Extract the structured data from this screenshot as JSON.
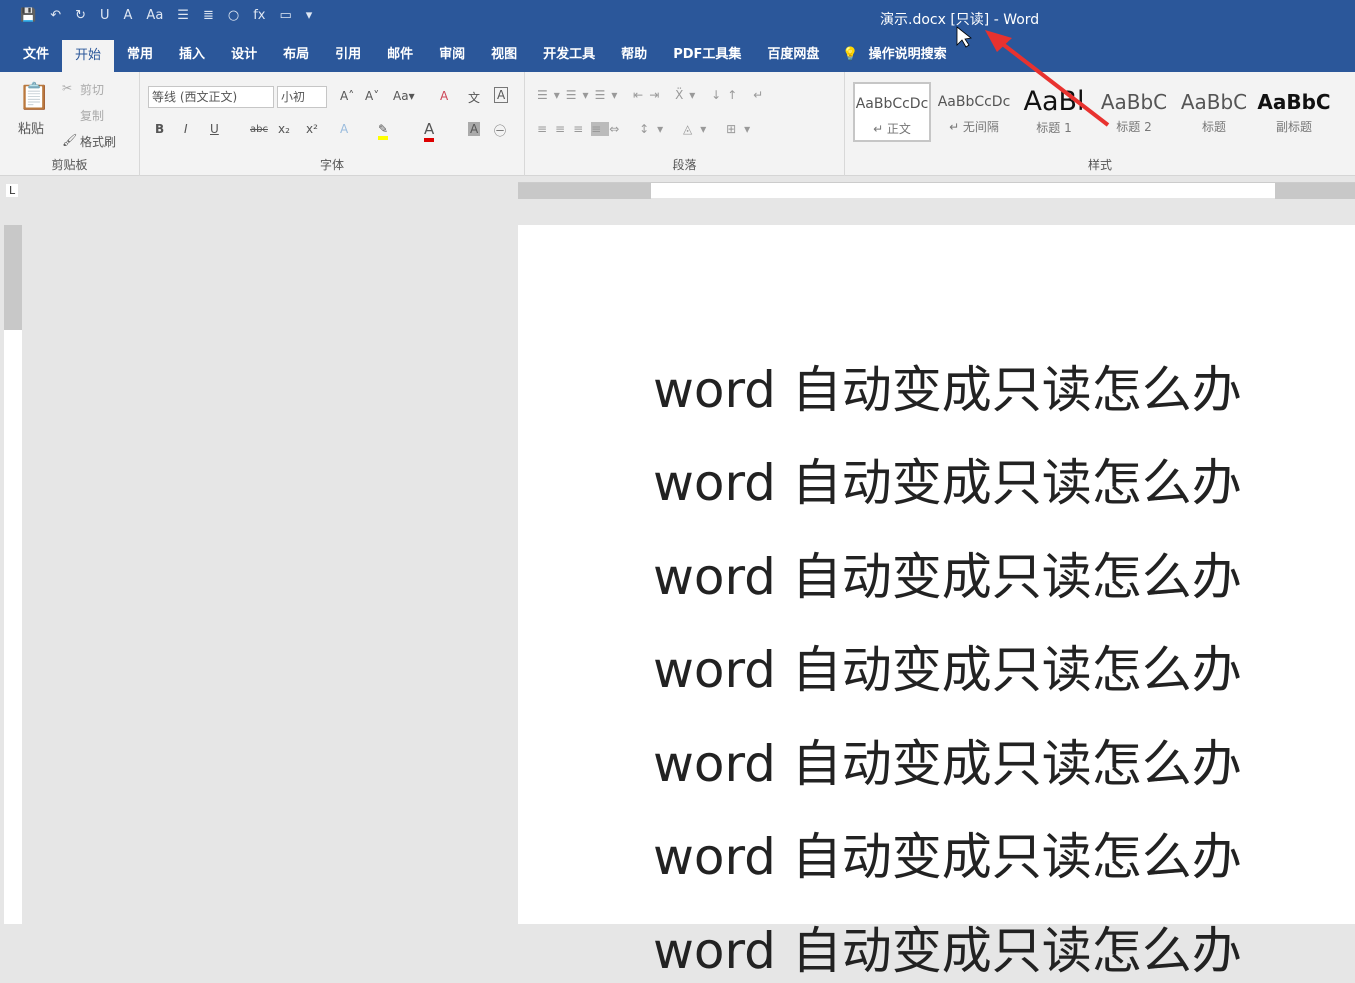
{
  "window": {
    "title": "演示.docx [只读]  -  Word"
  },
  "qat": [
    "save-icon",
    "undo-icon",
    "redo-icon",
    "U",
    "A",
    "Aa",
    "list-icon",
    "align-icon",
    "circle-icon",
    "fx",
    "comment-icon",
    "more-icon"
  ],
  "tabs": [
    "文件",
    "开始",
    "常用",
    "插入",
    "设计",
    "布局",
    "引用",
    "邮件",
    "审阅",
    "视图",
    "开发工具",
    "帮助",
    "PDF工具集",
    "百度网盘"
  ],
  "search_label": "操作说明搜索",
  "clipboard": {
    "paste": "粘贴",
    "cut": "剪切",
    "copy": "复制",
    "format_painter": "格式刷",
    "label": "剪贴板"
  },
  "font": {
    "name": "等线 (西文正文)",
    "size": "小初",
    "label": "字体",
    "buttons": [
      "B",
      "I",
      "U",
      "abc",
      "x₂",
      "x²"
    ]
  },
  "paragraph": {
    "label": "段落"
  },
  "styles": {
    "label": "样式",
    "items": [
      {
        "sample": "AaBbCcDc",
        "name": "↵ 正文"
      },
      {
        "sample": "AaBbCcDc",
        "name": "↵ 无间隔"
      },
      {
        "sample": "AaBl",
        "name": "标题 1"
      },
      {
        "sample": "AaBbC",
        "name": "标题 2"
      },
      {
        "sample": "AaBbC",
        "name": "标题"
      },
      {
        "sample": "AaBbC",
        "name": "副标题"
      }
    ]
  },
  "document": {
    "lines": [
      "word 自动变成只读怎么办",
      "word 自动变成只读怎么办",
      "word 自动变成只读怎么办",
      "word 自动变成只读怎么办",
      "word 自动变成只读怎么办",
      "word 自动变成只读怎么办",
      "word 自动变成只读怎么办"
    ]
  },
  "colors": {
    "brand": "#2b579a",
    "annotation_arrow": "#e8322f"
  }
}
